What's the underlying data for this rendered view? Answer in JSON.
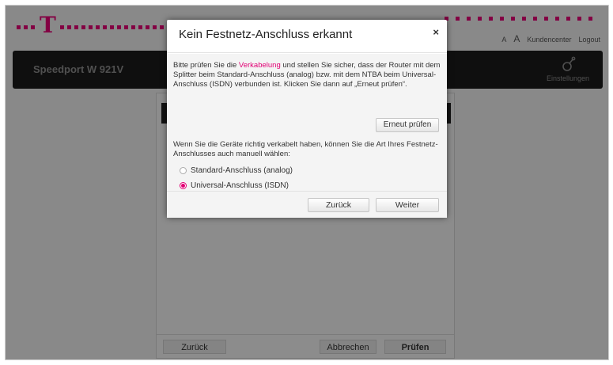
{
  "header": {
    "font_small_label": "A",
    "font_large_label": "A",
    "kundencenter": "Kundencenter",
    "logout": "Logout",
    "brand_color": "#e20074"
  },
  "navbar": {
    "product_name": "Speedport W 921V",
    "settings_label": "Einstellungen",
    "settings_icon": "gear-icon"
  },
  "panel_footer": {
    "back_label": "Zurück",
    "cancel_label": "Abbrechen",
    "check_label": "Prüfen"
  },
  "modal": {
    "title": "Kein Festnetz-Anschluss erkannt",
    "close_label": "×",
    "para1_before": "Bitte prüfen Sie die ",
    "para1_link": "Verkabelung",
    "para1_after": " und stellen Sie sicher, dass der Router mit dem Splitter beim Standard-Anschluss (analog) bzw. mit dem NTBA beim Universal-Anschluss (ISDN) verbunden ist. Klicken Sie dann auf „Erneut prüfen“.",
    "check_again_label": "Erneut prüfen",
    "para2": "Wenn Sie die Geräte richtig verkabelt haben, können Sie die Art Ihres Festnetz-Anschlusses auch manuell wählen:",
    "options": [
      {
        "label": "Standard-Anschluss (analog)",
        "selected": false
      },
      {
        "label": "Universal-Anschluss (ISDN)",
        "selected": true
      }
    ],
    "back_label": "Zurück",
    "next_label": "Weiter"
  }
}
